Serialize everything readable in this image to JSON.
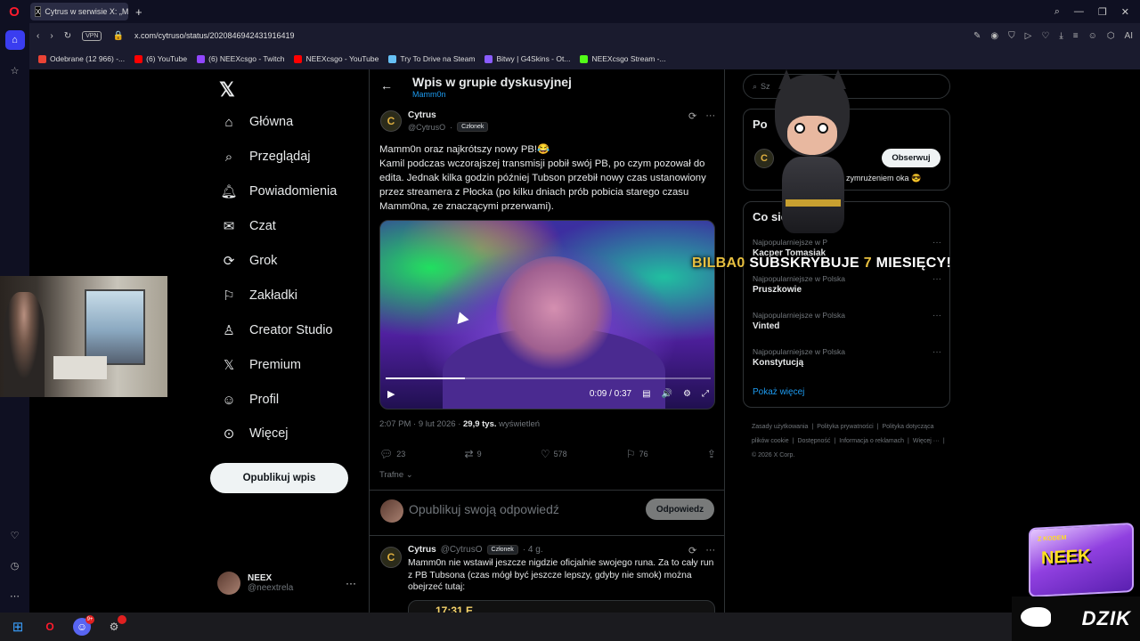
{
  "browser": {
    "tab_title": "Cytrus w serwisie X: „M...",
    "tab_icon": "x-logo-icon",
    "vpn_label": "VPN",
    "url": "x.com/cytruso/status/2020846942431916419",
    "ai_label": "AI",
    "bookmarks": [
      {
        "label": "Odebrane (12 966) -...",
        "color": "#ea4335"
      },
      {
        "label": "(6) YouTube",
        "color": "#ff0000"
      },
      {
        "label": "(6) NEEXcsgo - Twitch",
        "color": "#9146ff"
      },
      {
        "label": "NEEXcsgo - YouTube",
        "color": "#ff0000"
      },
      {
        "label": "Try To Drive na Steam",
        "color": "#66c0f4"
      },
      {
        "label": "Bitwy | G4Skins - Ot...",
        "color": "#8a5cff"
      },
      {
        "label": "NEEXcsgo Stream -...",
        "color": "#53fc18"
      }
    ]
  },
  "nav": {
    "items": [
      {
        "label": "Główna",
        "icon": "home-icon"
      },
      {
        "label": "Przeglądaj",
        "icon": "search-icon"
      },
      {
        "label": "Powiadomienia",
        "icon": "bell-icon"
      },
      {
        "label": "Czat",
        "icon": "mail-icon"
      },
      {
        "label": "Grok",
        "icon": "grok-icon"
      },
      {
        "label": "Zakładki",
        "icon": "bookmark-icon"
      },
      {
        "label": "Creator Studio",
        "icon": "creator-icon"
      },
      {
        "label": "Premium",
        "icon": "x-logo-icon"
      },
      {
        "label": "Profil",
        "icon": "person-icon"
      },
      {
        "label": "Więcej",
        "icon": "more-circle-icon"
      }
    ],
    "publish_label": "Opublikuj wpis",
    "account_name": "NEEX",
    "account_handle": "@neextrela"
  },
  "header": {
    "title": "Wpis w grupie dyskusyjnej",
    "subtitle": "Mamm0n"
  },
  "post": {
    "author": "Cytrus",
    "handle": "@CytrusO",
    "badge": "Członek",
    "line1": "Mamm0n oraz najkrótszy nowy PB!😂",
    "body": "Kamil podczas wczorajszej transmisji pobił swój PB, po czym pozował do edita. Jednak kilka godzin później Tubson przebił nowy czas ustanowiony przez streamera z Płocka (po kilku dniach prób pobicia starego czasu Mamm0na, ze znaczącymi przerwami).",
    "video_time": "0:09 / 0:37",
    "video_progress": 0.243,
    "timestamp": "2:07 PM · 9 lut 2026 · ",
    "views_count": "29,9 tys.",
    "views_label": " wyświetleń",
    "replies": "23",
    "reposts": "9",
    "likes": "578",
    "bookmarks": "76",
    "sort_label": "Trafne"
  },
  "reply_box": {
    "placeholder": "Opublikuj swoją odpowiedź",
    "button": "Odpowiedz"
  },
  "reply": {
    "author": "Cytrus",
    "handle": "@CytrusO",
    "badge": "Członek",
    "age": "· 4 g.",
    "text": "Mamm0n nie wstawił jeszcze nigdzie oficjalnie swojego runa. Za to cały run z PB Tubsona (czas mógł być jeszcze lepszy, gdyby nie smok) można obejrzeć tutaj:",
    "media_text": "17:31 E"
  },
  "sidebar": {
    "search_placeholder": "Sz",
    "card1_title": "Po",
    "follow_label": "Obserwuj",
    "card1_desc": "zymrużeniem oka 😎",
    "card2_title": "Co się",
    "trends": [
      {
        "context": "Najpopularniejsze w P",
        "name": "Kacper Tomasiak"
      },
      {
        "context": "Najpopularniejsze w Polska",
        "name": "Pruszkowie"
      },
      {
        "context": "Najpopularniejsze w Polska",
        "name": "Vinted"
      },
      {
        "context": "Najpopularniejsze w Polska",
        "name": "Konstytucją"
      }
    ],
    "show_more": "Pokaż więcej",
    "footer": [
      "Zasady użytkowania",
      "|",
      "Polityka prywatności",
      "|",
      "Polityka dotycząca plików cookie",
      "|",
      "Dostępność",
      "|",
      "Informacja o reklamach",
      "|",
      "Więcej ···",
      "|",
      "© 2026 X Corp."
    ]
  },
  "overlay": {
    "sub_user": "BILBA0",
    "sub_text": " SUBSKRYBUJE ",
    "sub_months": "7",
    "sub_end": " MIESIĘCY!",
    "neek_top": "Z KODEM",
    "neek_label": "NEEK",
    "dzik_label": "DZIK"
  },
  "taskbar": {
    "discord_badge": "9+"
  }
}
